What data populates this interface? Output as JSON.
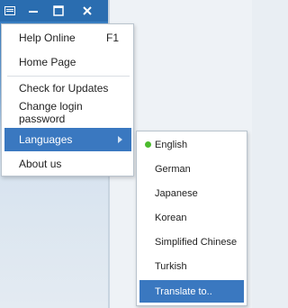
{
  "main_menu": {
    "items": [
      {
        "label": "Help Online",
        "shortcut": "F1"
      },
      {
        "label": "Home Page"
      },
      {
        "label": "Check for Updates"
      },
      {
        "label": "Change login password"
      },
      {
        "label": "Languages"
      },
      {
        "label": "About us"
      }
    ]
  },
  "languages_submenu": {
    "selected": "English",
    "items": [
      {
        "label": "English",
        "checked": true
      },
      {
        "label": "German"
      },
      {
        "label": "Japanese"
      },
      {
        "label": "Korean"
      },
      {
        "label": "Simplified Chinese"
      },
      {
        "label": "Turkish"
      },
      {
        "label": "Translate to.."
      }
    ]
  },
  "colors": {
    "titlebar": "#2a6db0",
    "highlight": "#3a78c0",
    "selected_dot": "#4cbb2e"
  },
  "icons": [
    "menu-icon",
    "minimize-icon",
    "maximize-icon",
    "close-icon",
    "submenu-arrow-icon",
    "selected-dot-icon"
  ]
}
